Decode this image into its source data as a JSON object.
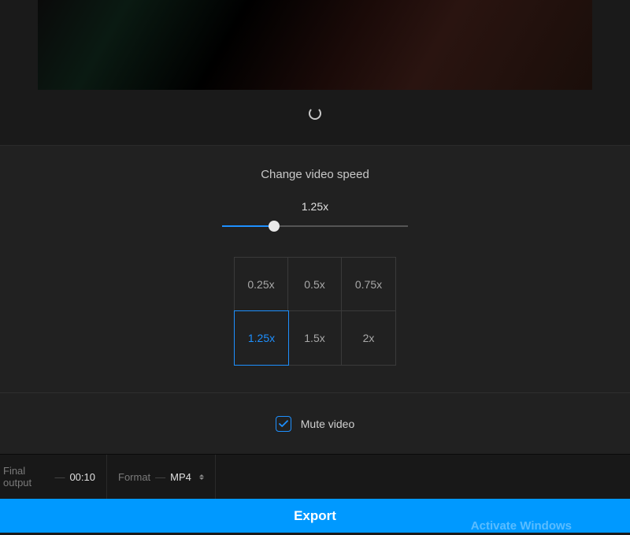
{
  "section_title": "Change video speed",
  "speed": {
    "current_label": "1.25x",
    "slider_percent": 28,
    "options": [
      "0.25x",
      "0.5x",
      "0.75x",
      "1.25x",
      "1.5x",
      "2x"
    ],
    "active_index": 3
  },
  "mute": {
    "label": "Mute video",
    "checked": true
  },
  "info": {
    "output_label": "Final output",
    "output_value": "00:10",
    "format_label": "Format",
    "format_value": "MP4"
  },
  "export_label": "Export",
  "watermark": "Activate Windows"
}
